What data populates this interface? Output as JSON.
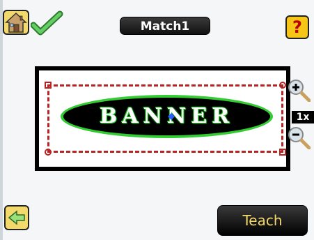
{
  "header": {
    "title": "Match1",
    "home_icon": "home-icon",
    "status_icon": "pass-checkmark-icon",
    "help_label": "?"
  },
  "viewer": {
    "target_text": "BANNER",
    "zoom_level": "1x",
    "zoom_in_icon": "zoom-in-icon",
    "zoom_out_icon": "zoom-out-icon"
  },
  "footer": {
    "back_icon": "back-arrow-icon",
    "teach_label": "Teach"
  },
  "colors": {
    "accent_yellow": "#f3d96b",
    "pass_green": "#3c3",
    "roi_red": "#b22",
    "button_dark": "#111111"
  }
}
